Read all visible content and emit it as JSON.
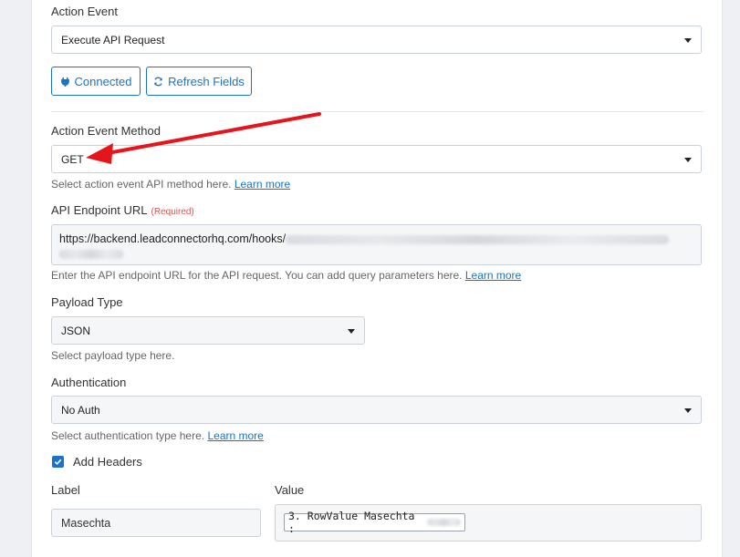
{
  "action_event": {
    "label": "Action Event",
    "value": "Execute API Request"
  },
  "buttons": {
    "connected": "Connected",
    "refresh": "Refresh Fields"
  },
  "method": {
    "label": "Action Event Method",
    "value": "GET",
    "help": "Select action event API method here.",
    "help_link": "Learn more"
  },
  "endpoint": {
    "label": "API Endpoint URL",
    "required": "(Required)",
    "value": "https://backend.leadconnectorhq.com/hooks/",
    "help": "Enter the API endpoint URL for the API request. You can add query parameters here.",
    "help_link": "Learn more"
  },
  "payload": {
    "label": "Payload Type",
    "value": "JSON",
    "help": "Select payload type here."
  },
  "auth": {
    "label": "Authentication",
    "value": "No Auth",
    "help": "Select authentication type here.",
    "help_link": "Learn more"
  },
  "headers": {
    "checkbox_label": "Add Headers",
    "checked": true,
    "label_col": "Label",
    "value_col": "Value",
    "row_label": "Masechta",
    "row_value": "3. RowValue Masechta :"
  },
  "colors": {
    "accent": "#1a73c9",
    "arrow": "#e8141b"
  }
}
